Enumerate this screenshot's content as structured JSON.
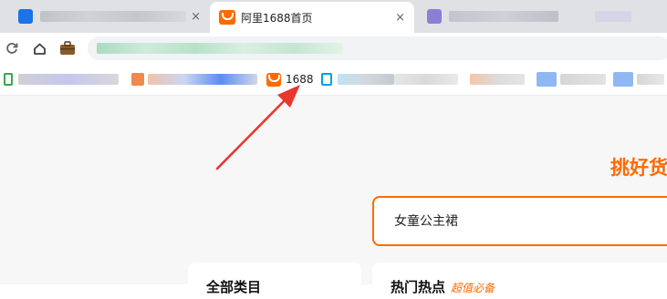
{
  "tabs": {
    "active": {
      "title": "阿里1688首页",
      "close": "×"
    },
    "inactive_close": "×"
  },
  "toolbar": {
    "reload_icon": "reload-icon",
    "home_icon": "home-icon",
    "briefcase_icon": "briefcase-icon"
  },
  "bookmarks": {
    "highlight_label": "1688"
  },
  "page": {
    "slogan": "挑好货",
    "search": {
      "value": "女童公主裙"
    },
    "card_left_title": "全部类目",
    "card_right_title": "热门热点",
    "card_right_sub": "超值必备"
  },
  "colors": {
    "brand_orange": "#ff6a00",
    "annotation_red": "#e8372c"
  }
}
